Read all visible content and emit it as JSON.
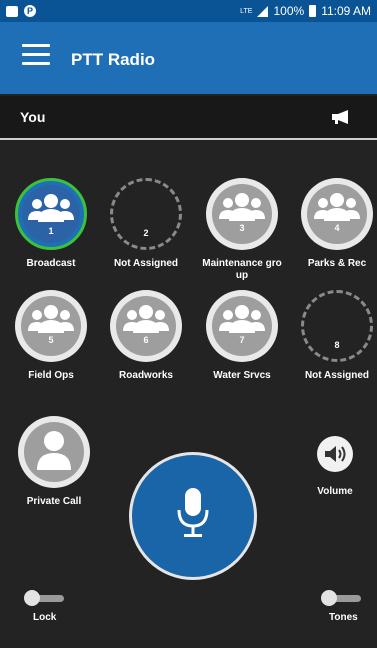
{
  "status_bar": {
    "network": "LTE",
    "battery": "100%",
    "time": "11:09 AM"
  },
  "app_bar": {
    "title": "PTT Radio"
  },
  "you_row": {
    "label": "You"
  },
  "groups": [
    {
      "number": "1",
      "label": "Broadcast",
      "state": "selected"
    },
    {
      "number": "2",
      "label": "Not Assigned",
      "state": "empty"
    },
    {
      "number": "3",
      "label": "Maintenance gro up",
      "state": "normal"
    },
    {
      "number": "4",
      "label": "Parks & Rec",
      "state": "normal"
    },
    {
      "number": "5",
      "label": "Field Ops",
      "state": "normal"
    },
    {
      "number": "6",
      "label": "Roadworks",
      "state": "normal"
    },
    {
      "number": "7",
      "label": "Water Srvcs",
      "state": "normal"
    },
    {
      "number": "8",
      "label": "Not Assigned",
      "state": "empty"
    }
  ],
  "private_call": {
    "label": "Private Call"
  },
  "volume": {
    "label": "Volume"
  },
  "lock": {
    "label": "Lock"
  },
  "tones": {
    "label": "Tones"
  },
  "colors": {
    "status_bar": "#0a5394",
    "app_bar": "#1f6fb6",
    "background": "#232323",
    "selected_ring": "#3cc13c",
    "ptt_button": "#1a64a8"
  }
}
